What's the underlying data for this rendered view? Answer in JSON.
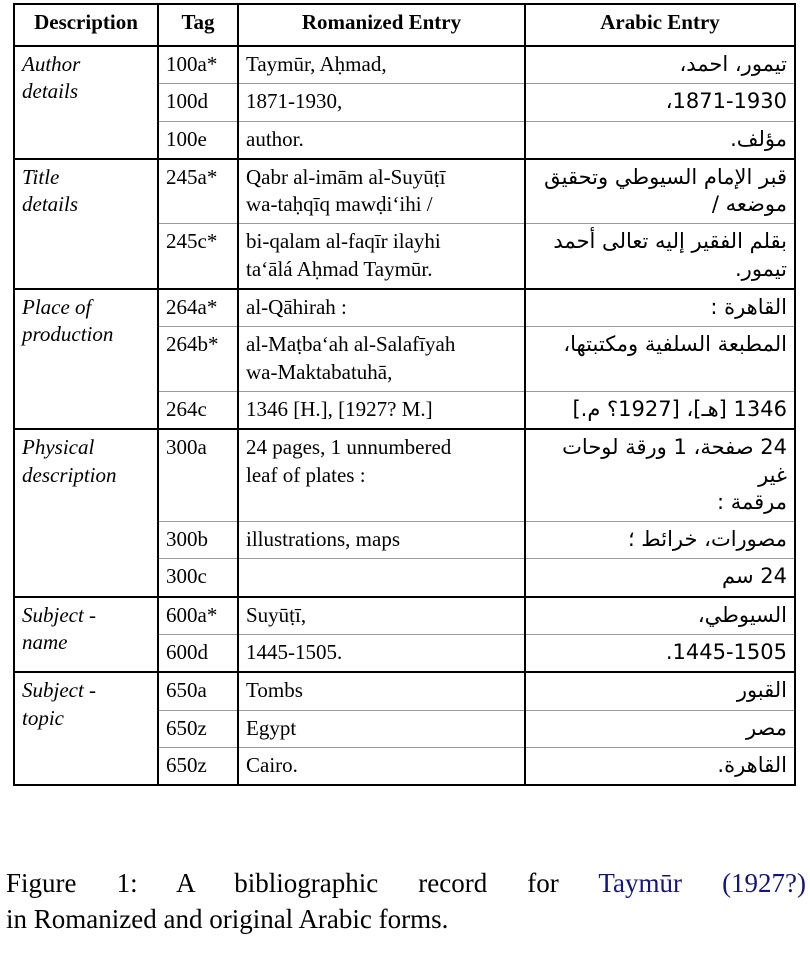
{
  "table": {
    "headers": {
      "description": "Description",
      "tag": "Tag",
      "romanized": "Romanized Entry",
      "arabic": "Arabic Entry"
    },
    "groups": [
      {
        "description_line1": "Author",
        "description_line2": "details",
        "rows": [
          {
            "tag": "100a*",
            "romanized_line1": "Taymūr, Aḥmad,",
            "romanized_line2": "",
            "arabic": "تيمور، احمد،"
          },
          {
            "tag": "100d",
            "romanized_line1": "1871-1930,",
            "romanized_line2": "",
            "arabic": "1871-1930،"
          },
          {
            "tag": "100e",
            "romanized_line1": "author.",
            "romanized_line2": "",
            "arabic": "مؤلف."
          }
        ]
      },
      {
        "description_line1": "Title",
        "description_line2": "details",
        "rows": [
          {
            "tag": "245a*",
            "romanized_line1": "Qabr al-imām al-Suyūṭī",
            "romanized_line2": "wa-taḥqīq mawḍi‘ihi /",
            "arabic_line1": "قبر الإمام السيوطي وتحقيق",
            "arabic_line2": "موضعه /"
          },
          {
            "tag": "245c*",
            "romanized_line1": "bi-qalam al-faqīr ilayhi",
            "romanized_line2": "ta‘ālá Aḥmad Taymūr.",
            "arabic_line1": "بقلم الفقير إليه تعالى أحمد تيمور.",
            "arabic_line2": ""
          }
        ]
      },
      {
        "description_line1": "Place of",
        "description_line2": "production",
        "rows": [
          {
            "tag": "264a*",
            "romanized_line1": "al-Qāhirah :",
            "romanized_line2": "",
            "arabic_line1": "القاهرة :",
            "arabic_line2": ""
          },
          {
            "tag": "264b*",
            "romanized_line1": "al-Maṭba‘ah al-Salafīyah",
            "romanized_line2": "wa-Maktabatuhā,",
            "arabic_line1": "المطبعة السلفية ومكتبتها،",
            "arabic_line2": ""
          },
          {
            "tag": "264c",
            "romanized_line1": "1346 [H.], [1927? M.]",
            "romanized_line2": "",
            "arabic_line1": "1346 [هـ]، [1927؟ م.]",
            "arabic_line2": ""
          }
        ]
      },
      {
        "description_line1": "Physical",
        "description_line2": "description",
        "rows": [
          {
            "tag": "300a",
            "romanized_line1": "24 pages, 1 unnumbered",
            "romanized_line2": "leaf of plates :",
            "arabic_line1": "24 صفحة، 1 ورقة لوحات غير",
            "arabic_line2": "مرقمة :"
          },
          {
            "tag": "300b",
            "romanized_line1": "illustrations, maps",
            "romanized_line2": "",
            "arabic_line1": "مصورات، خرائط ؛",
            "arabic_line2": ""
          },
          {
            "tag": "300c",
            "romanized_line1": "",
            "romanized_line2": "",
            "arabic_line1": "24 سم",
            "arabic_line2": ""
          }
        ]
      },
      {
        "description_line1": "Subject -",
        "description_line2": "name",
        "rows": [
          {
            "tag": "600a*",
            "romanized_line1": "Suyūṭī,",
            "romanized_line2": "",
            "arabic_line1": "السيوطي،",
            "arabic_line2": ""
          },
          {
            "tag": "600d",
            "romanized_line1": "1445-1505.",
            "romanized_line2": "",
            "arabic_line1": "1445-1505.",
            "arabic_line2": ""
          }
        ]
      },
      {
        "description_line1": "Subject -",
        "description_line2": "topic",
        "rows": [
          {
            "tag": "650a",
            "romanized_line1": "Tombs",
            "romanized_line2": "",
            "arabic_line1": "القبور",
            "arabic_line2": ""
          },
          {
            "tag": "650z",
            "romanized_line1": "Egypt",
            "romanized_line2": "",
            "arabic_line1": "مصر",
            "arabic_line2": ""
          },
          {
            "tag": "650z",
            "romanized_line1": "Cairo.",
            "romanized_line2": "",
            "arabic_line1": "القاهرة.",
            "arabic_line2": ""
          }
        ]
      }
    ]
  },
  "caption": {
    "label": "Figure 1:",
    "text_before_cite": "A bibliographic record for",
    "cite_author": "Taymūr",
    "cite_year": "(1927?)",
    "text_after_cite": "in Romanized and original Arabic forms.",
    "cite_color": "#151580"
  }
}
